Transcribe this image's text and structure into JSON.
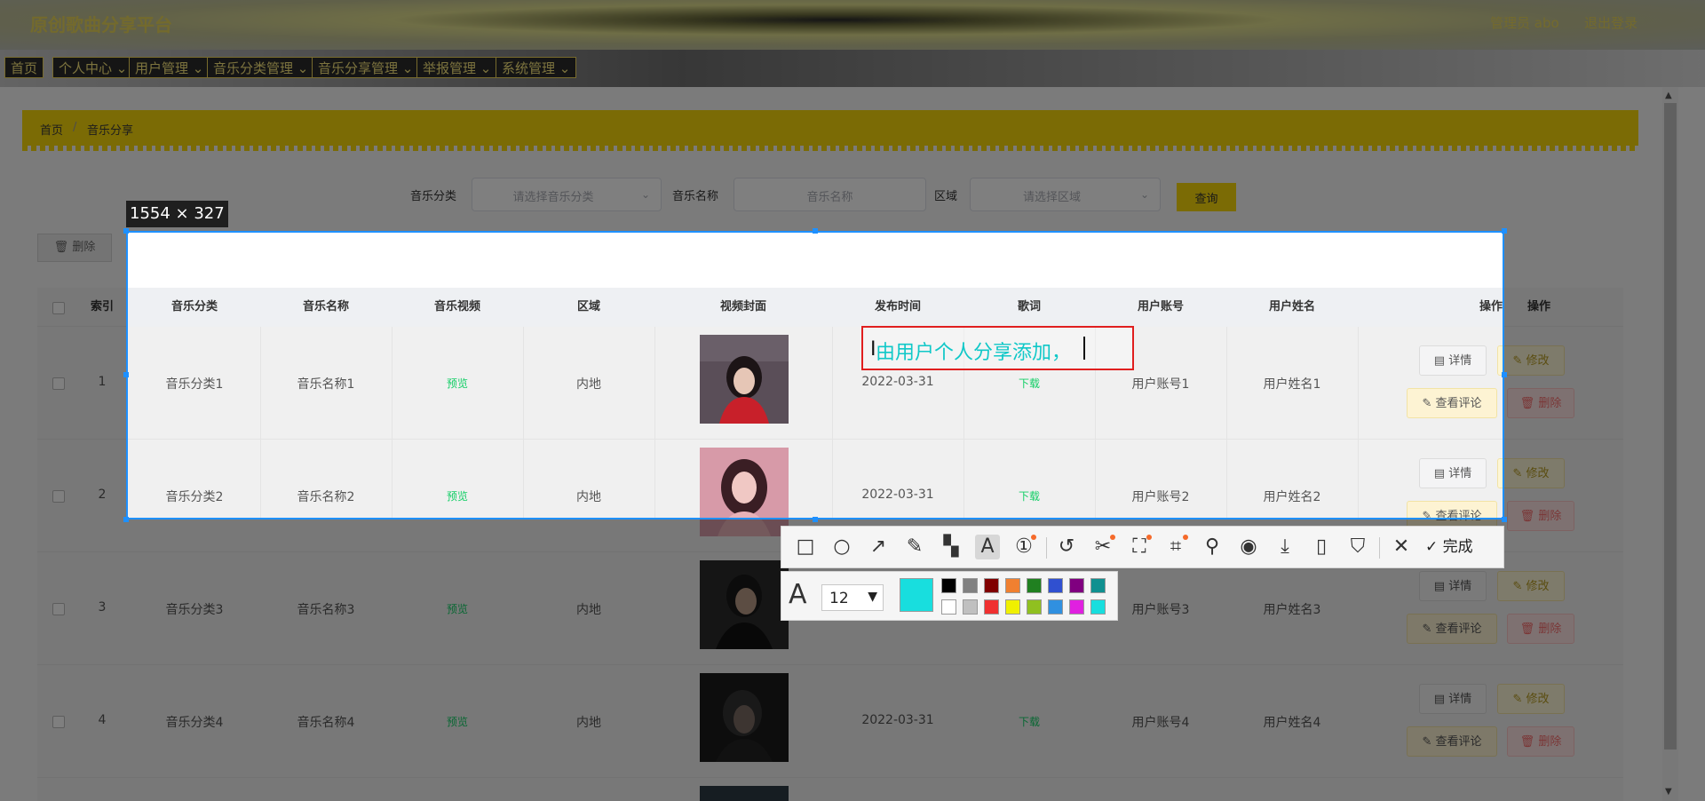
{
  "app": {
    "title": "原创歌曲分享平台",
    "admin_text": "管理员 abo",
    "logout_text": "退出登录"
  },
  "nav": [
    {
      "label": "首页",
      "has_dropdown": false
    },
    {
      "label": "个人中心",
      "has_dropdown": true
    },
    {
      "label": "用户管理",
      "has_dropdown": true
    },
    {
      "label": "音乐分类管理",
      "has_dropdown": true
    },
    {
      "label": "音乐分享管理",
      "has_dropdown": true
    },
    {
      "label": "举报管理",
      "has_dropdown": true
    },
    {
      "label": "系统管理",
      "has_dropdown": true
    }
  ],
  "breadcrumb": {
    "home": "首页",
    "sep": "/",
    "current": "音乐分享"
  },
  "filters": {
    "category_label": "音乐分类",
    "category_placeholder": "请选择音乐分类",
    "name_label": "音乐名称",
    "name_placeholder": "音乐名称",
    "region_label": "区域",
    "region_placeholder": "请选择区域",
    "query_button": "查询"
  },
  "delete_button": "删除",
  "table": {
    "headers": [
      "索引",
      "音乐分类",
      "音乐名称",
      "音乐视频",
      "区域",
      "视频封面",
      "发布时间",
      "歌词",
      "用户账号",
      "用户姓名",
      "操作"
    ],
    "rows": [
      {
        "index": "1",
        "category": "音乐分类1",
        "name": "音乐名称1",
        "video": "预览",
        "region": "内地",
        "time": "2022-03-31",
        "lyrics": "下载",
        "account": "用户账号1",
        "username": "用户姓名1"
      },
      {
        "index": "2",
        "category": "音乐分类2",
        "name": "音乐名称2",
        "video": "预览",
        "region": "内地",
        "time": "2022-03-31",
        "lyrics": "下载",
        "account": "用户账号2",
        "username": "用户姓名2"
      },
      {
        "index": "3",
        "category": "音乐分类3",
        "name": "音乐名称3",
        "video": "预览",
        "region": "内地",
        "time": "",
        "lyrics": "",
        "account": "用户账号3",
        "username": "用户姓名3"
      },
      {
        "index": "4",
        "category": "音乐分类4",
        "name": "音乐名称4",
        "video": "预览",
        "region": "内地",
        "time": "2022-03-31",
        "lyrics": "下载",
        "account": "用户账号4",
        "username": "用户姓名4"
      }
    ],
    "actions": {
      "detail": "详情",
      "edit": "修改",
      "comment": "查看评论",
      "delete": "删除"
    }
  },
  "screenshot_tool": {
    "size_label": "1554 × 327",
    "annotation_text": "由用户个人分享添加，",
    "done_label": "完成",
    "font_size": "12",
    "current_color": "#18dede",
    "palette": [
      "#000000",
      "#808080",
      "#800000",
      "#f08030",
      "#208020",
      "#3050d0",
      "#800080",
      "#109090",
      "#ffffff",
      "#c0c0c0",
      "#f03030",
      "#f0f000",
      "#90c020",
      "#3090e0",
      "#e020e0",
      "#18dede"
    ]
  }
}
